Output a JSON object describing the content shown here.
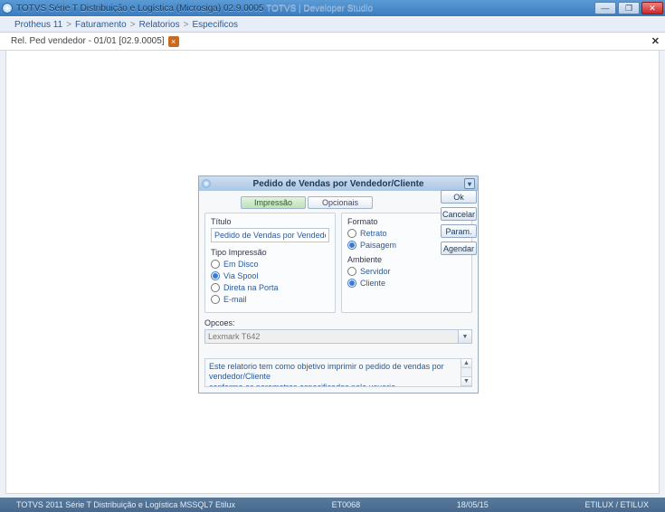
{
  "titlebar": {
    "text_main": "TOTVS Série T Distribuição e Logística (Microsiga) 02.9.0005",
    "text_faded": "TOTVS | Developer Studio"
  },
  "breadcrumb": [
    "Protheus 11",
    "Faturamento",
    "Relatorios",
    "Especificos"
  ],
  "tab": {
    "label": "Rel. Ped vendedor - 01/01 [02.9.0005]"
  },
  "dialog": {
    "title": "Pedido de Vendas por Vendedor/Cliente",
    "tabs": {
      "impressao": "Impressão",
      "opcionais": "Opcionais"
    },
    "titulo_label": "Título",
    "titulo_value": "Pedido de Vendas por Vendedor/Cliente",
    "tipo_label": "Tipo Impressão",
    "tipo_options": {
      "disco": "Em Disco",
      "spool": "Via Spool",
      "porta": "Direta na Porta",
      "email": "E-mail"
    },
    "formato_label": "Formato",
    "formato_options": {
      "retrato": "Retrato",
      "paisagem": "Paisagem"
    },
    "ambiente_label": "Ambiente",
    "ambiente_options": {
      "servidor": "Servidor",
      "cliente": "Cliente"
    },
    "opcoes_label": "Opcoes:",
    "opcoes_value": "Lexmark T642",
    "desc_line1": "Este relatorio tem como objetivo imprimir o pedido de vendas por vendedor/Cliente",
    "desc_line2": "conforme os parametros especificados pelo usuario."
  },
  "buttons": {
    "ok": "Ok",
    "cancelar": "Cancelar",
    "param": "Param.",
    "agendar": "Agendar"
  },
  "status": {
    "left": "TOTVS 2011 Série T Distribuição e Logística MSSQL7 Etilux",
    "field1": "ET0068",
    "field2": "18/05/15",
    "right": "ETILUX / ETILUX"
  }
}
